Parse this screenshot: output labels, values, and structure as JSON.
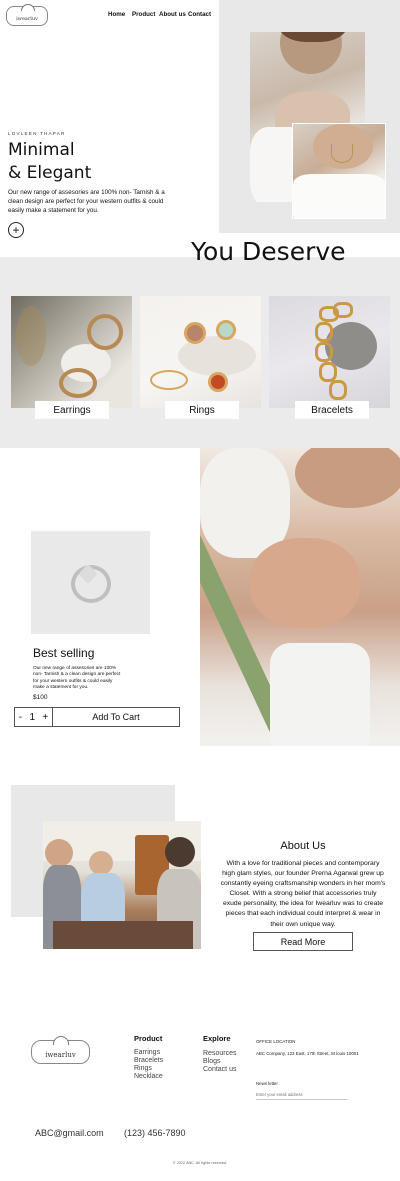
{
  "brand": {
    "name": "iwearluv"
  },
  "nav": {
    "items": [
      "Home",
      "Product",
      "About us",
      "Contact"
    ]
  },
  "hero": {
    "eyebrow": "LOVLEEN THAPAR",
    "title_line1": "Minimal",
    "title_line2": "& Elegant",
    "description": "Our new range of assesories are 100% non- Tarnish & a clean design are perfect  for your western outfits & could easily make a statement for you.",
    "plus_label": "+"
  },
  "deserve": {
    "title": "You Deserve",
    "categories": [
      "Earrings",
      "Rings",
      "Bracelets"
    ]
  },
  "best_selling": {
    "title": "Best selling",
    "description": "Our new range of assesories are 100% non- Tarnish & a clean design are perfect for your western outfits & could easily make a statement for you.",
    "price": "$100",
    "qty_minus": "-",
    "qty_value": "1",
    "qty_plus": "+",
    "cart_label": "Add To Cart"
  },
  "about": {
    "title": "About Us",
    "text": "With a love for traditional pieces and contemporary high glam styles, our founder Prerna Agarwal grew up constantly eyeing craftsmanship wonders in her mom's Closet. With a strong belief that accessories truly exude personality, the idea for Iwearluv was to create pieces that each individual could interpret & wear in their own unique way.",
    "button": "Read More"
  },
  "footer": {
    "product_heading": "Product",
    "product_links": [
      "Earrings",
      "Bracelets",
      "Rings",
      "Necklace"
    ],
    "explore_heading": "Explore",
    "explore_links": [
      "Resources",
      "Blogs",
      "Contact us"
    ],
    "office_heading": "OFFICE LOCATION",
    "office_address": "ABC Company, 123 East, 17th Street, St louis 10001",
    "newsletter_heading": "News letter",
    "newsletter_placeholder": "Enter your email address",
    "email": "ABC@gmail.com",
    "phone": "(123) 456-7890",
    "copyright": "© 2022 ABC. All rights reserved."
  }
}
